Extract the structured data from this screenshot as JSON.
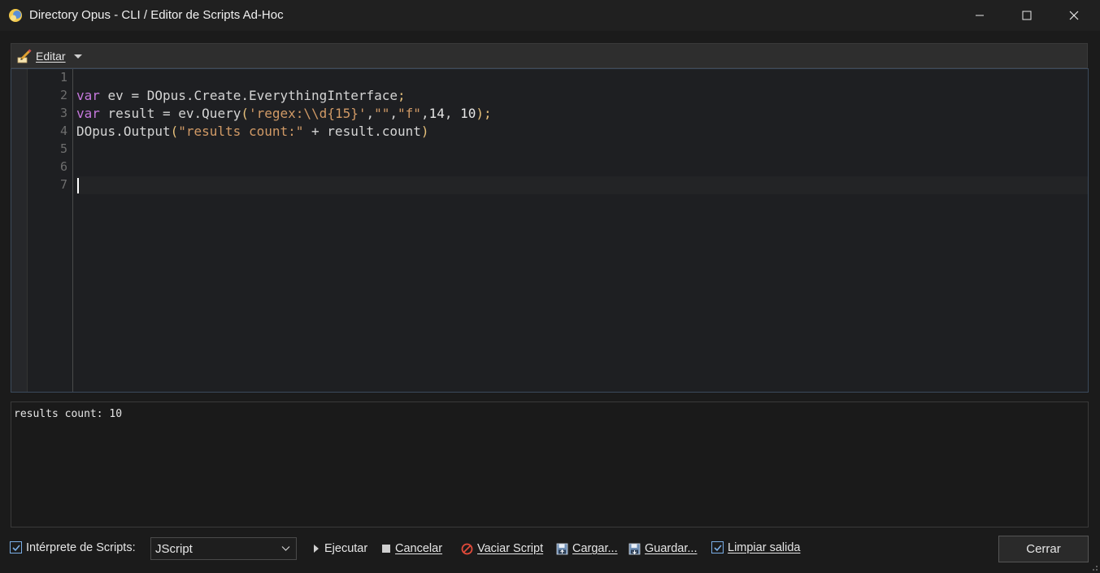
{
  "window": {
    "title": "Directory Opus - CLI / Editor de Scripts Ad-Hoc"
  },
  "toolbar": {
    "edit_label": "Editar"
  },
  "editor": {
    "line_numbers": [
      "1",
      "2",
      "3",
      "4",
      "5",
      "6",
      "7"
    ],
    "lines": [
      "",
      "var ev = DOpus.Create.EverythingInterface;",
      "var result = ev.Query('regex:\\\\d{15}',\"\",\"f\",14, 10);",
      "DOpus.Output(\"results count:\" + result.count)",
      "",
      "",
      ""
    ],
    "caret_line": 7
  },
  "output": {
    "text": "results count: 10"
  },
  "bottombar": {
    "interpreter_label": "Intérprete de Scripts:",
    "interpreter_checked": true,
    "interpreter_value": "JScript",
    "run_label": "Ejecutar",
    "cancel_label": "Cancelar",
    "clear_script_label": "Vaciar Script",
    "load_label": "Cargar...",
    "save_label": "Guardar...",
    "clear_output_label": "Limpiar salida",
    "clear_output_checked": true,
    "close_label": "Cerrar"
  },
  "colors": {
    "keyword": "#c678dd",
    "string": "#d19a66",
    "accent": "#7aaee6"
  }
}
